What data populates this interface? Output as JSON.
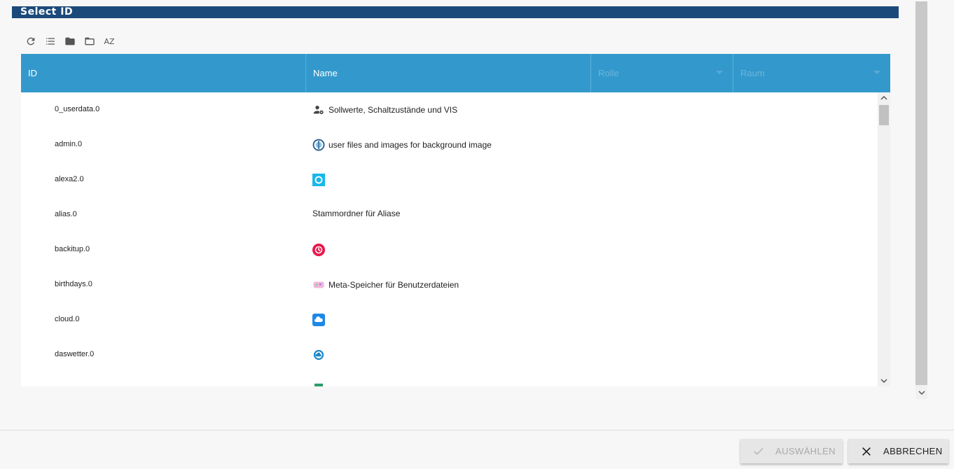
{
  "dialog": {
    "title": "Select ID"
  },
  "toolbar": {
    "refresh_icon": "refresh-icon",
    "list_icon": "list-icon",
    "folder_closed_icon": "folder-closed-icon",
    "folder_open_icon": "folder-open-icon",
    "sort_label": "AZ"
  },
  "columns": {
    "id": "ID",
    "name": "Name",
    "role": "Rolle",
    "room": "Raum"
  },
  "rows": [
    {
      "id": "0_userdata.0",
      "name": "Sollwerte, Schaltzustände und VIS",
      "icon": "user-gear-icon"
    },
    {
      "id": "admin.0",
      "name": "user files and images for background image",
      "icon": "admin-logo-icon"
    },
    {
      "id": "alexa2.0",
      "name": "",
      "icon": "alexa-icon"
    },
    {
      "id": "alias.0",
      "name": "Stammordner für Aliase",
      "icon": ""
    },
    {
      "id": "backitup.0",
      "name": "",
      "icon": "backitup-icon"
    },
    {
      "id": "birthdays.0",
      "name": "Meta-Speicher für Benutzerdateien",
      "icon": "birthdays-icon"
    },
    {
      "id": "cloud.0",
      "name": "",
      "icon": "cloud-icon"
    },
    {
      "id": "daswetter.0",
      "name": "",
      "icon": "weather-icon"
    }
  ],
  "footer": {
    "select_label": "AUSWÄHLEN",
    "cancel_label": "ABBRECHEN"
  },
  "colors": {
    "title_bg": "#1b4a7a",
    "header_bg": "#3399cc",
    "backitup": "#e8174a",
    "alexa": "#17b8e8",
    "cloud": "#1e88e5"
  }
}
